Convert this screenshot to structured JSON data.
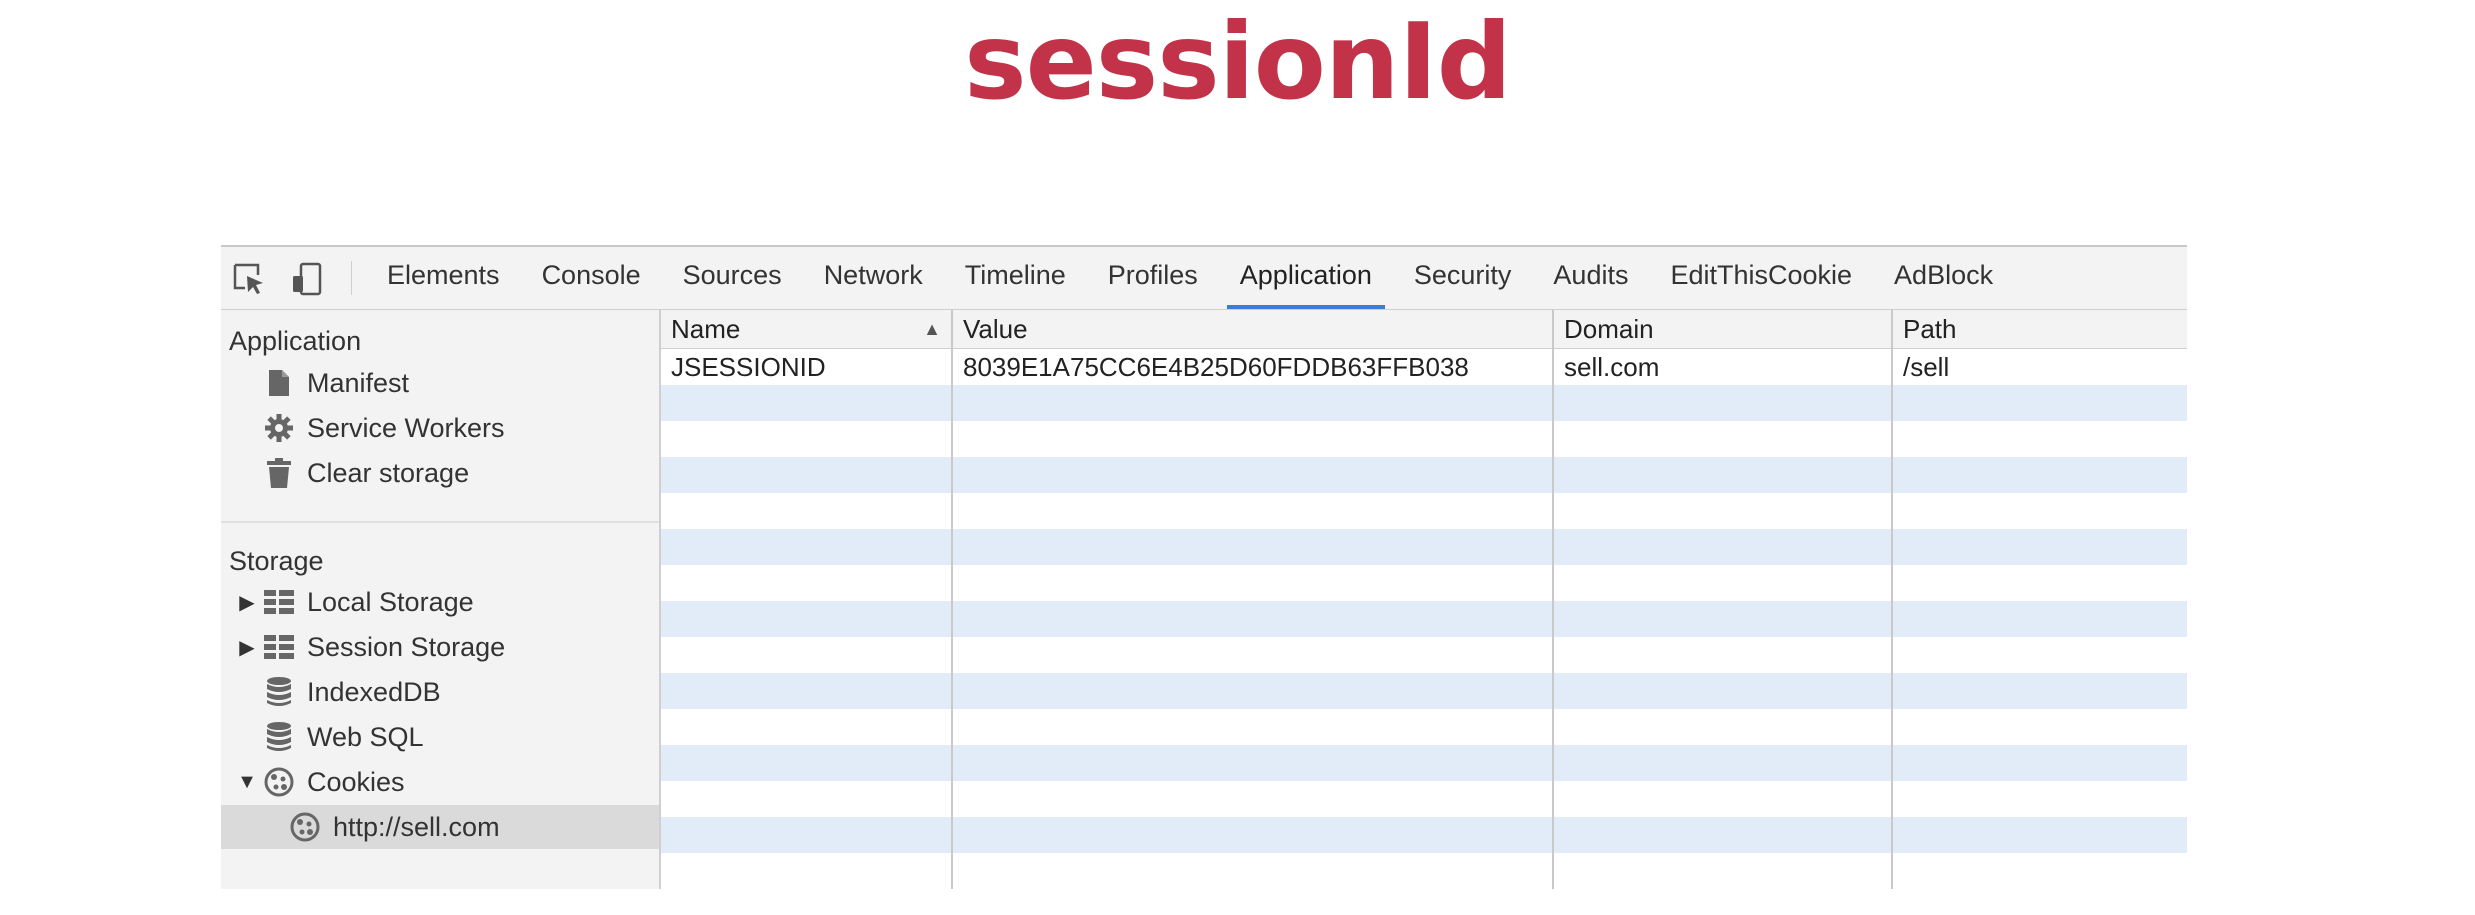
{
  "title": {
    "text": "sessionId",
    "color": "#c23349"
  },
  "toolbar": {
    "tabs": [
      {
        "label": "Elements"
      },
      {
        "label": "Console"
      },
      {
        "label": "Sources"
      },
      {
        "label": "Network"
      },
      {
        "label": "Timeline"
      },
      {
        "label": "Profiles"
      },
      {
        "label": "Application",
        "active": true
      },
      {
        "label": "Security"
      },
      {
        "label": "Audits"
      },
      {
        "label": "EditThisCookie"
      },
      {
        "label": "AdBlock"
      }
    ],
    "icons": [
      "inspect-element-icon",
      "device-mode-icon"
    ]
  },
  "sidebar": {
    "application": {
      "title": "Application",
      "items": [
        {
          "label": "Manifest",
          "icon": "file-icon"
        },
        {
          "label": "Service Workers",
          "icon": "gear-icon"
        },
        {
          "label": "Clear storage",
          "icon": "trash-icon"
        }
      ]
    },
    "storage": {
      "title": "Storage",
      "items": [
        {
          "label": "Local Storage",
          "icon": "grid-icon",
          "expand": "collapsed"
        },
        {
          "label": "Session Storage",
          "icon": "grid-icon",
          "expand": "collapsed"
        },
        {
          "label": "IndexedDB",
          "icon": "database-icon"
        },
        {
          "label": "Web SQL",
          "icon": "database-icon"
        },
        {
          "label": "Cookies",
          "icon": "cookie-icon",
          "expand": "expanded"
        },
        {
          "label": "http://sell.com",
          "icon": "cookie-icon",
          "selected": true
        }
      ]
    }
  },
  "table": {
    "columns": [
      "Name",
      "Value",
      "Domain",
      "Path"
    ],
    "sorted_column": "Name",
    "rows": [
      [
        "JSESSIONID",
        "8039E1A75CC6E4B25D60FDDB63FFB038",
        "sell.com",
        "/sell"
      ]
    ]
  },
  "colors": {
    "accent": "#3a7dd8",
    "stripe": "#e2ecf8",
    "panel": "#f3f3f3"
  }
}
